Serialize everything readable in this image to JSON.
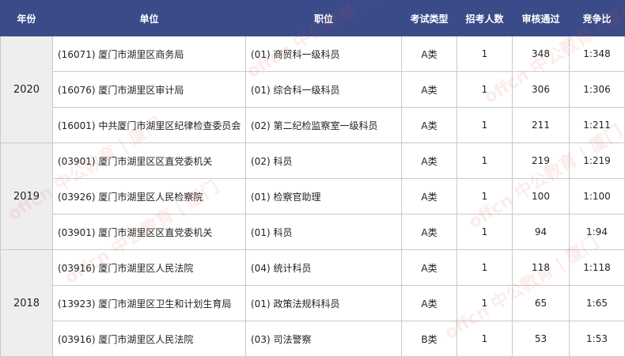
{
  "headers": {
    "year": "年份",
    "unit": "单位",
    "position": "职位",
    "exam_type": "考试类型",
    "recruits": "招考人数",
    "approved": "审核通过",
    "ratio": "竞争比"
  },
  "groups": [
    {
      "year": "2020",
      "rows": [
        {
          "unit": "(16071) 厦门市湖里区商务局",
          "position": "(01) 商贸科一级科员",
          "exam_type": "A类",
          "recruits": "1",
          "approved": "348",
          "ratio": "1:348"
        },
        {
          "unit": "(16076) 厦门市湖里区审计局",
          "position": "(01) 综合科一级科员",
          "exam_type": "A类",
          "recruits": "1",
          "approved": "306",
          "ratio": "1:306"
        },
        {
          "unit": "(16001) 中共厦门市湖里区纪律检查委员会",
          "position": "(02) 第二纪检监察室一级科员",
          "exam_type": "A类",
          "recruits": "1",
          "approved": "211",
          "ratio": "1:211"
        }
      ]
    },
    {
      "year": "2019",
      "rows": [
        {
          "unit": "(03901) 厦门市湖里区区直党委机关",
          "position": "(02) 科员",
          "exam_type": "A类",
          "recruits": "1",
          "approved": "219",
          "ratio": "1:219"
        },
        {
          "unit": "(03926) 厦门市湖里区人民检察院",
          "position": "(01) 检察官助理",
          "exam_type": "A类",
          "recruits": "1",
          "approved": "100",
          "ratio": "1:100"
        },
        {
          "unit": "(03901) 厦门市湖里区区直党委机关",
          "position": "(01) 科员",
          "exam_type": "A类",
          "recruits": "1",
          "approved": "94",
          "ratio": "1:94"
        }
      ]
    },
    {
      "year": "2018",
      "rows": [
        {
          "unit": "(03916) 厦门市湖里区人民法院",
          "position": "(04) 统计科员",
          "exam_type": "A类",
          "recruits": "1",
          "approved": "118",
          "ratio": "1:118"
        },
        {
          "unit": "(13923) 厦门市湖里区卫生和计划生育局",
          "position": "(01) 政策法规科科员",
          "exam_type": "A类",
          "recruits": "1",
          "approved": "65",
          "ratio": "1:65"
        },
        {
          "unit": "(03916) 厦门市湖里区人民法院",
          "position": "(03) 司法警察",
          "exam_type": "B类",
          "recruits": "1",
          "approved": "53",
          "ratio": "1:53"
        }
      ]
    }
  ],
  "watermark": "offcn 中公教育 | 厦门"
}
